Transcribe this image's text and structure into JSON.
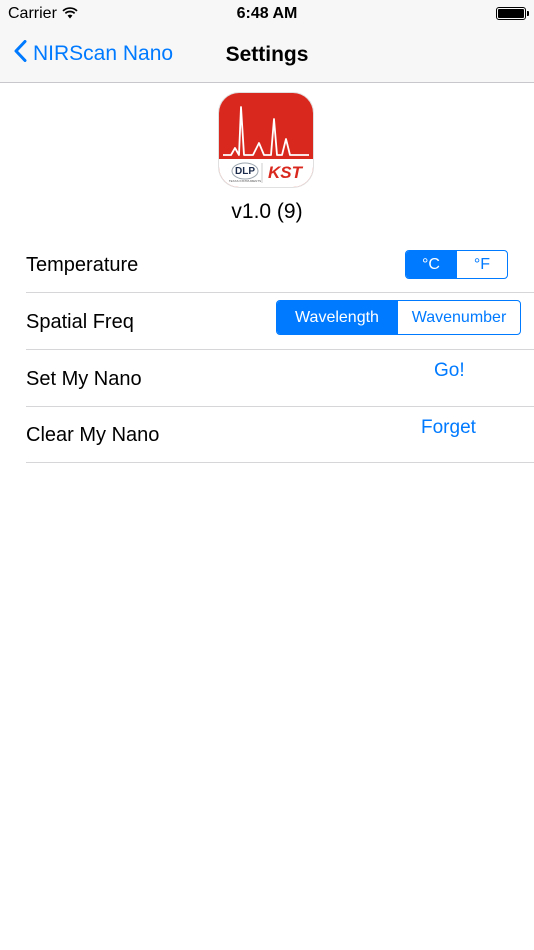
{
  "status_bar": {
    "carrier": "Carrier",
    "time": "6:48 AM"
  },
  "nav": {
    "back_label": "NIRScan Nano",
    "title": "Settings"
  },
  "app": {
    "version": "v1.0 (9)",
    "logo_text_left": "DLP",
    "logo_subtext": "TEXAS INSTRUMENTS",
    "logo_text_right": "KST"
  },
  "settings": {
    "temperature": {
      "label": "Temperature",
      "options": [
        "°C",
        "°F"
      ],
      "selected": "°C"
    },
    "spatial_freq": {
      "label": "Spatial Freq",
      "options": [
        "Wavelength",
        "Wavenumber"
      ],
      "selected": "Wavelength"
    },
    "set_my_nano": {
      "label": "Set My Nano",
      "action": "Go!"
    },
    "clear_my_nano": {
      "label": "Clear My Nano",
      "action": "Forget"
    }
  },
  "colors": {
    "accent": "#007aff",
    "icon_red": "#d9291f"
  }
}
